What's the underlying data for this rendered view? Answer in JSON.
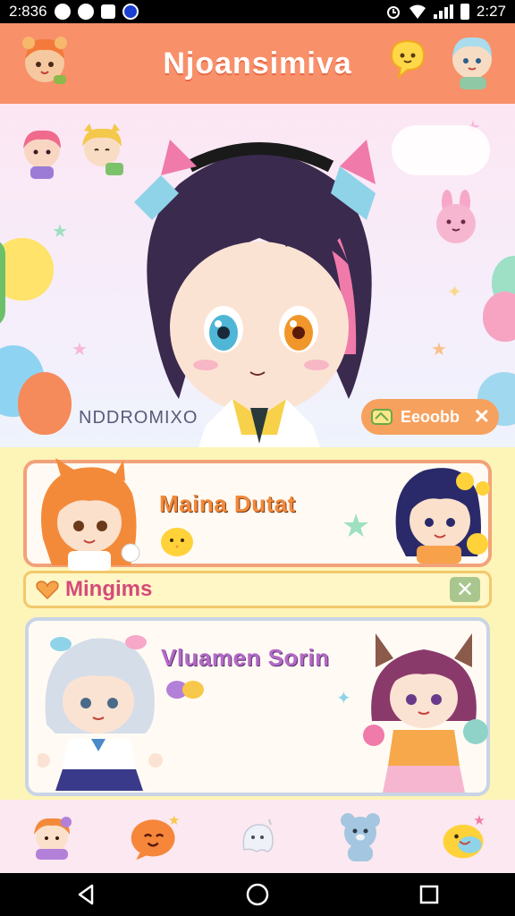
{
  "status_bar": {
    "left_time": "2:836",
    "right_time": "2:27"
  },
  "header": {
    "title": "Njoansimiva",
    "left_avatar_icon": "chibi-avatar-icon",
    "chat_icon": "chat-bubble-icon",
    "right_avatar_icon": "chibi-avatar-icon"
  },
  "hero": {
    "caption": "NDDROMIXO",
    "chip_label": "Eeoobb",
    "chip_close": "✕"
  },
  "cards": [
    {
      "title": "Maina Dutat"
    },
    {
      "title": "Vluamen Sorin"
    }
  ],
  "banner": {
    "label": "Mingims",
    "close": "✕"
  },
  "bottom_nav": [
    {
      "icon": "chibi-girl-icon"
    },
    {
      "icon": "orange-chat-icon"
    },
    {
      "icon": "ghost-icon"
    },
    {
      "icon": "bear-icon"
    },
    {
      "icon": "duck-icon"
    }
  ],
  "system_nav": [
    {
      "icon": "back-icon"
    },
    {
      "icon": "home-icon"
    },
    {
      "icon": "recents-icon"
    }
  ],
  "colors": {
    "header_bg": "#f8906a",
    "content_bg": "#fdf4b8",
    "card1_border": "#f2a27a",
    "card1_title": "#f28a3d",
    "card2_title": "#b36ac6",
    "banner_label": "#d54a7a"
  }
}
